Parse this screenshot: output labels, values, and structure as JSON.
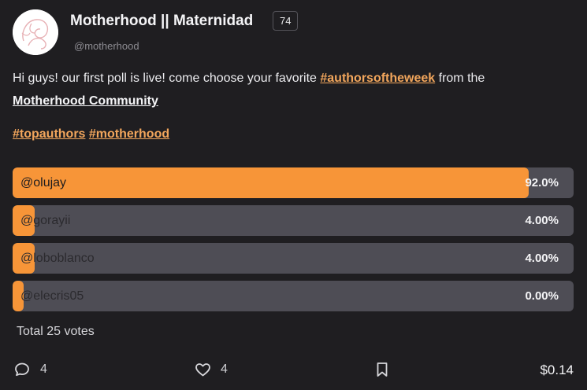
{
  "community": {
    "name": "Motherhood || Maternidad",
    "score": "74",
    "handle": "@motherhood"
  },
  "post": {
    "text_prefix": "Hi guys! our first poll is live! come choose your favorite ",
    "tag_inline": "#authorsoftheweek",
    "text_middle": " from the ",
    "community_link": "Motherhood Community",
    "tags": [
      "#topauthors",
      "#motherhood"
    ]
  },
  "poll": {
    "options": [
      {
        "label": "@olujay",
        "percent_text": "92.0%",
        "percent": 92.0
      },
      {
        "label": "@gorayii",
        "percent_text": "4.00%",
        "percent": 4.0
      },
      {
        "label": "@loboblanco",
        "percent_text": "4.00%",
        "percent": 4.0
      },
      {
        "label": "@elecris05",
        "percent_text": "0.00%",
        "percent": 0.0
      }
    ],
    "total": "Total 25 votes"
  },
  "footer": {
    "comments": "4",
    "likes": "4",
    "payout": "$0.14"
  },
  "colors": {
    "accent": "#f79538",
    "link": "#f2a65c",
    "track": "#4e4d55",
    "background": "#1f1e21"
  }
}
